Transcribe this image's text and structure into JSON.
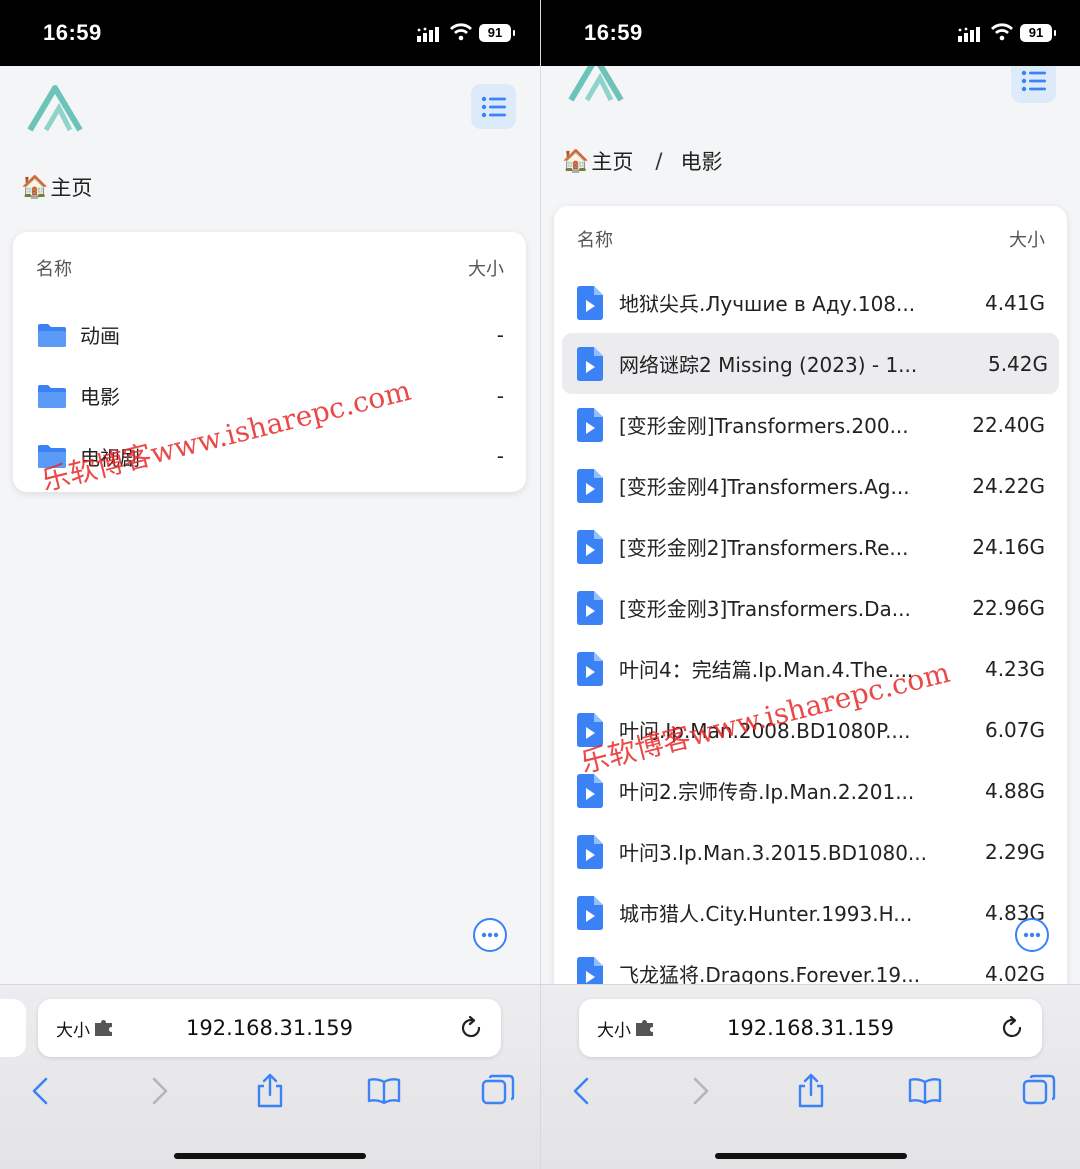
{
  "status": {
    "time": "16:59",
    "battery": "91"
  },
  "left": {
    "breadcrumb": {
      "home": "主页"
    },
    "table": {
      "col_name": "名称",
      "col_size": "大小"
    },
    "folders": [
      {
        "name": "动画",
        "size": "-"
      },
      {
        "name": "电影",
        "size": "-"
      },
      {
        "name": "电视剧",
        "size": "-"
      }
    ],
    "watermark": "乐软博客www.isharepc.com"
  },
  "right": {
    "breadcrumb": {
      "home": "主页",
      "sep": "/",
      "current": "电影"
    },
    "table": {
      "col_name": "名称",
      "col_size": "大小"
    },
    "files": [
      {
        "name": "地狱尖兵.Лучшие в Аду.108...",
        "size": "4.41G"
      },
      {
        "name": "网络谜踪2 Missing (2023) - 1...",
        "size": "5.42G",
        "highlight": true
      },
      {
        "name": "[变形金刚]Transformers.200...",
        "size": "22.40G"
      },
      {
        "name": "[变形金刚4]Transformers.Ag...",
        "size": "24.22G"
      },
      {
        "name": "[变形金刚2]Transformers.Re...",
        "size": "24.16G"
      },
      {
        "name": "[变形金刚3]Transformers.Da...",
        "size": "22.96G"
      },
      {
        "name": "叶问4：完结篇.Ip.Man.4.The....",
        "size": "4.23G"
      },
      {
        "name": "叶问.Ip.Man.2008.BD1080P....",
        "size": "6.07G"
      },
      {
        "name": "叶问2.宗师传奇.Ip.Man.2.201...",
        "size": "4.88G"
      },
      {
        "name": "叶问3.Ip.Man.3.2015.BD1080...",
        "size": "2.29G"
      },
      {
        "name": "城市猎人.City.Hunter.1993.H...",
        "size": "4.83G"
      },
      {
        "name": "飞龙猛将.Dragons.Forever.19...",
        "size": "4.02G"
      }
    ],
    "watermark": "乐软博客www.isharepc.com"
  },
  "safari": {
    "text_size": "大小",
    "url": "192.168.31.159"
  },
  "colors": {
    "accent": "#3b82f6",
    "logo": "#6cc3b8",
    "watermark": "#e82828"
  },
  "icons": [
    "folder-icon",
    "video-file-icon",
    "list-menu-icon",
    "more-icon",
    "back-icon",
    "forward-icon",
    "share-icon",
    "bookmarks-icon",
    "tabs-icon",
    "reload-icon",
    "puzzle-icon"
  ]
}
